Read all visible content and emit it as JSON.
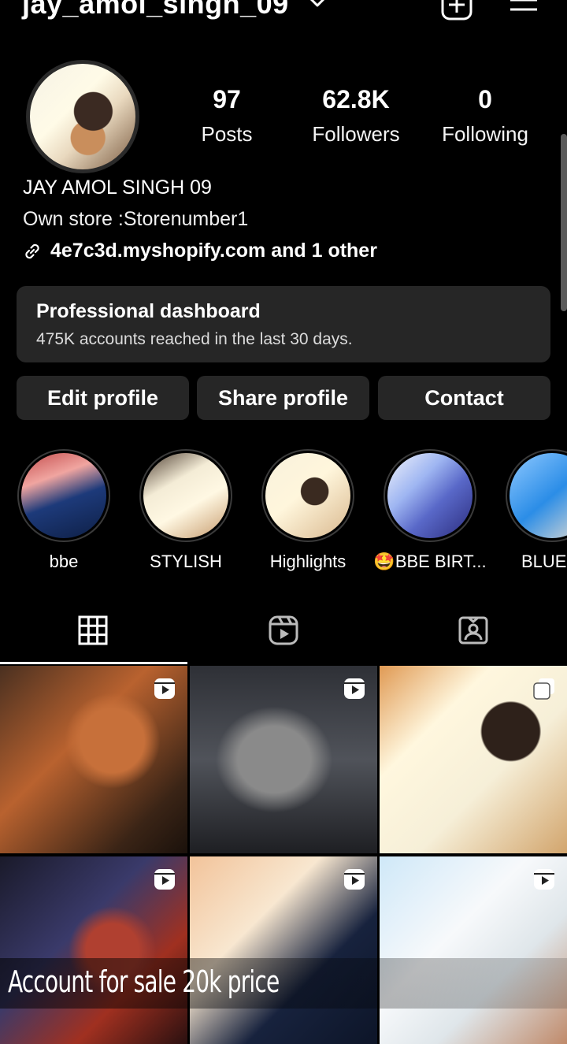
{
  "header": {
    "username": "jay_amol_singh_09",
    "icons": [
      "chevron-down-icon",
      "add-post-icon",
      "menu-icon"
    ]
  },
  "profile": {
    "stats": {
      "posts": {
        "value": "97",
        "label": "Posts"
      },
      "followers": {
        "value": "62.8K",
        "label": "Followers"
      },
      "following": {
        "value": "0",
        "label": "Following"
      }
    },
    "display_name": "JAY AMOL SINGH 09",
    "bio": "Own store :Storenumber1",
    "link_text": "4e7c3d.myshopify.com and 1 other"
  },
  "dashboard": {
    "title": "Professional dashboard",
    "subtitle": "475K accounts reached in the last 30 days."
  },
  "buttons": {
    "edit": "Edit profile",
    "share": "Share profile",
    "contact": "Contact"
  },
  "highlights": [
    {
      "label": "bbe"
    },
    {
      "label": "STYLISH"
    },
    {
      "label": "Highlights"
    },
    {
      "label": "🤩BBE BIRT..."
    },
    {
      "label": "BLUE🤩"
    }
  ],
  "tabs": [
    "grid-icon",
    "reels-icon",
    "tagged-icon"
  ],
  "overlay": {
    "caption": "Account for sale 20k price"
  },
  "colors": {
    "background": "#000000",
    "card": "#262626",
    "text": "#ffffff"
  }
}
